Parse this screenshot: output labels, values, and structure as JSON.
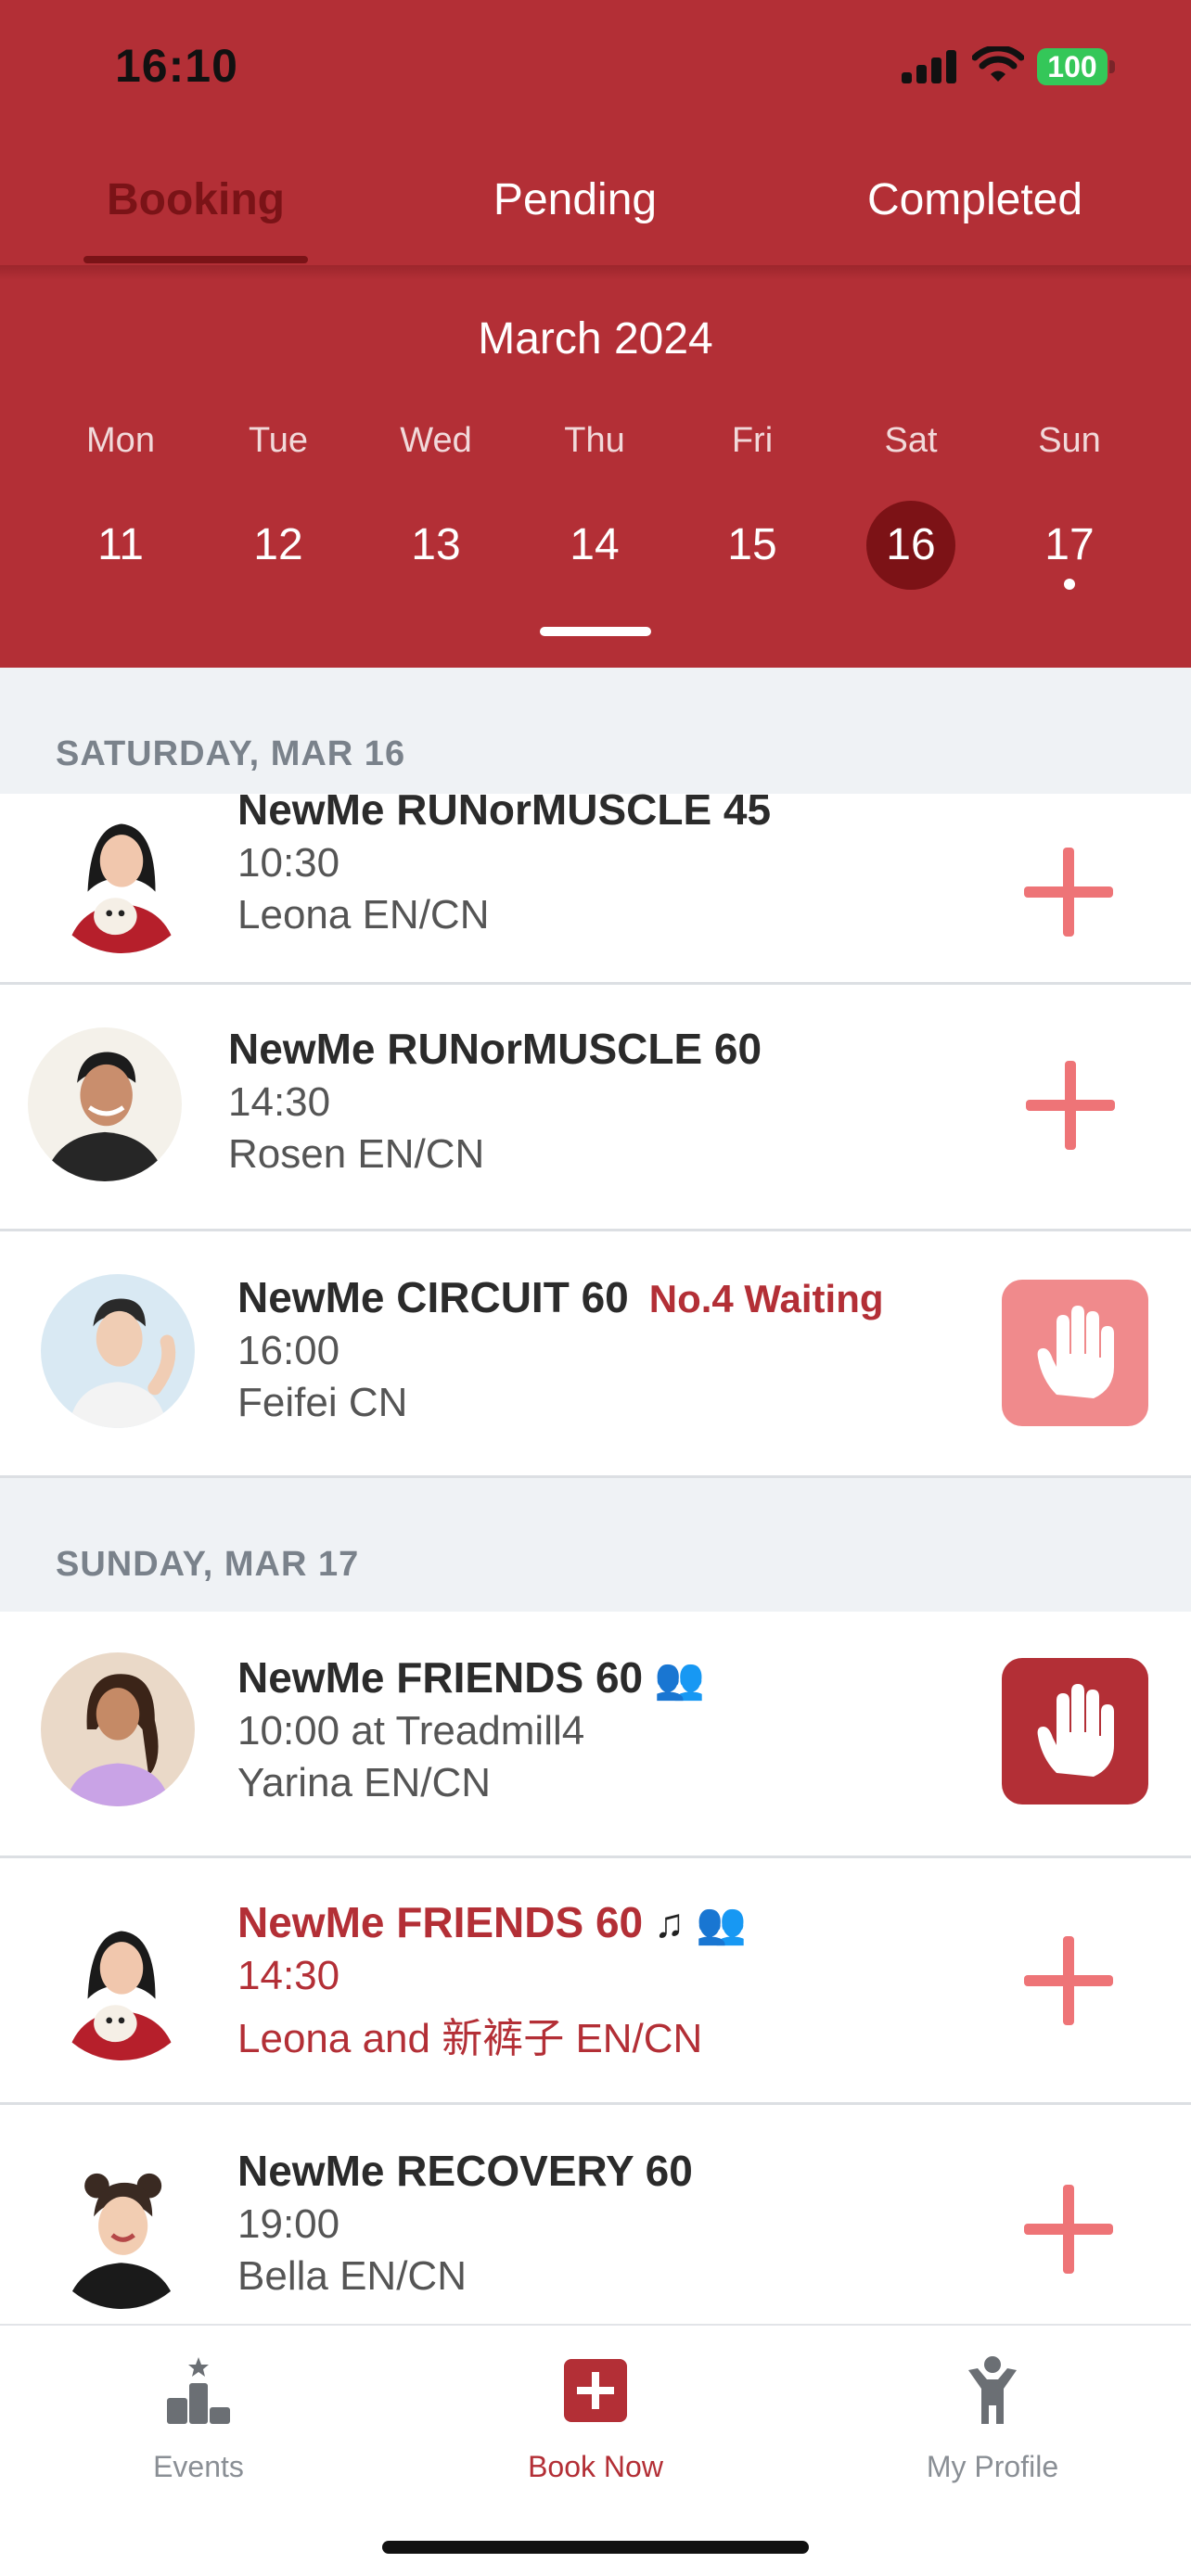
{
  "status_bar": {
    "time": "16:10",
    "battery": "100"
  },
  "tabs": [
    {
      "label": "Booking",
      "active": true
    },
    {
      "label": "Pending",
      "active": false
    },
    {
      "label": "Completed",
      "active": false
    }
  ],
  "calendar": {
    "month": "March 2024",
    "weekdays": [
      "Mon",
      "Tue",
      "Wed",
      "Thu",
      "Fri",
      "Sat",
      "Sun"
    ],
    "dates": [
      "11",
      "12",
      "13",
      "14",
      "15",
      "16",
      "17"
    ],
    "selected_date": "16"
  },
  "sections": [
    {
      "header": "SATURDAY, MAR 16",
      "classes": [
        {
          "title": "NewMe RUNorMUSCLE 45",
          "time": "10:30",
          "coach": "Leona EN/CN",
          "action": "add"
        },
        {
          "title": "NewMe RUNorMUSCLE 60",
          "time": "14:30",
          "coach": "Rosen EN/CN",
          "action": "add"
        },
        {
          "title": "NewMe CIRCUIT 60",
          "waiting": "No.4 Waiting",
          "time": "16:00",
          "coach": "Feifei CN",
          "action": "waitlist"
        }
      ]
    },
    {
      "header": "SUNDAY, MAR 17",
      "classes": [
        {
          "title": "NewMe FRIENDS 60",
          "time": "10:00 at Treadmill4",
          "coach": "Yarina EN/CN",
          "action": "waitlist-joined",
          "icons": [
            "friends-icon"
          ]
        },
        {
          "title": "NewMe FRIENDS 60",
          "time": "14:30",
          "coach": "Leona and 新裤子  EN/CN",
          "action": "add",
          "icons": [
            "music-note-icon",
            "friends-icon"
          ]
        },
        {
          "title": "NewMe RECOVERY 60",
          "time": "19:00",
          "coach": "Bella EN/CN",
          "action": "add"
        }
      ]
    }
  ],
  "tabbar": [
    {
      "label": "Events",
      "icon": "podium-icon"
    },
    {
      "label": "Book Now",
      "icon": "book-plus-icon",
      "active": true
    },
    {
      "label": "My Profile",
      "icon": "person-icon"
    }
  ],
  "colors": {
    "brand": "#b32f36",
    "selected_date": "#7c1216",
    "add": "#ee7477"
  }
}
